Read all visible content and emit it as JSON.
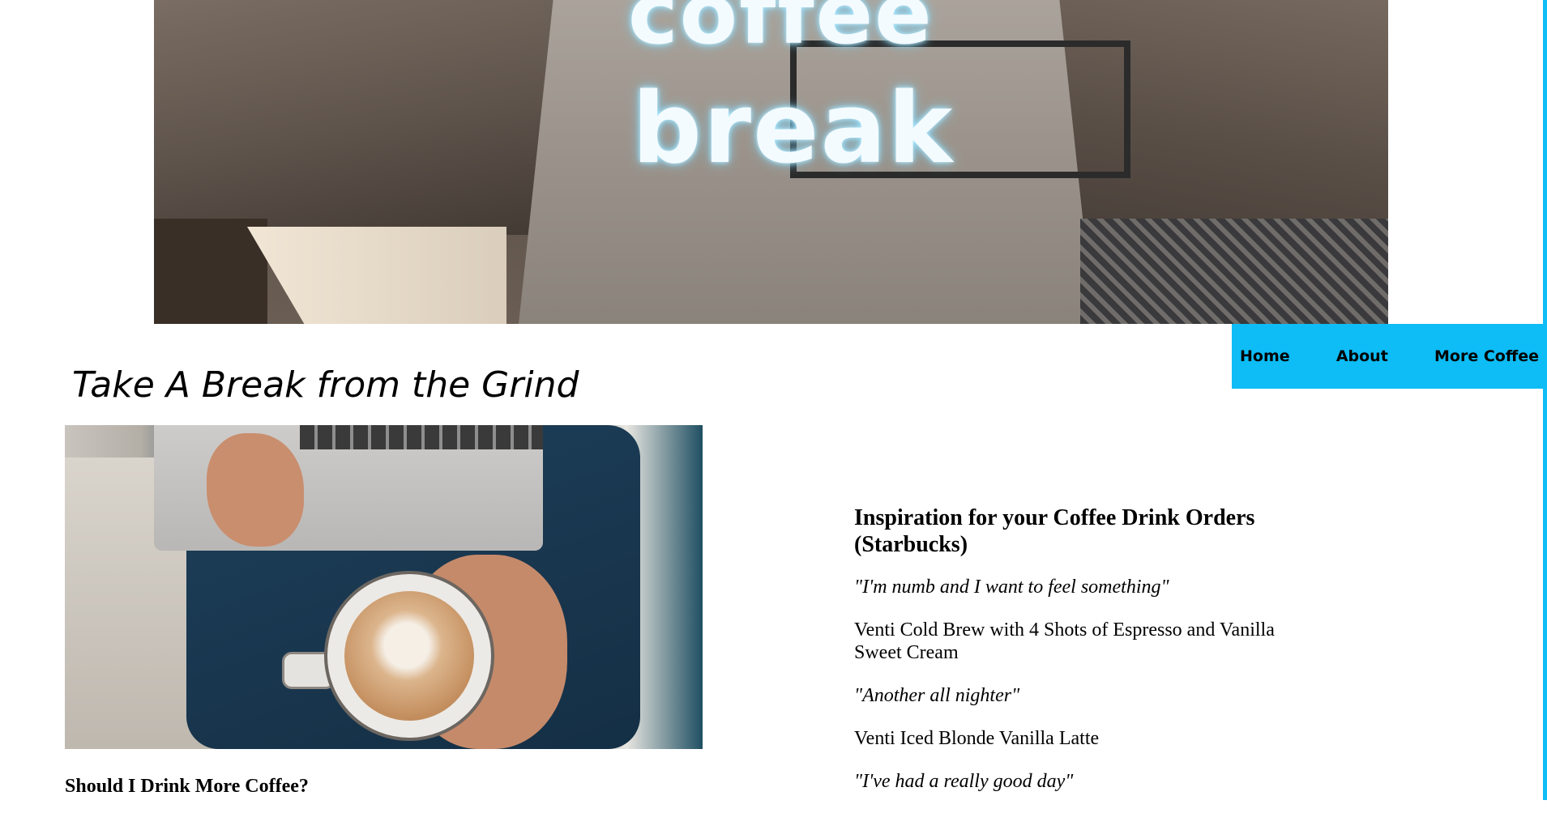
{
  "hero": {
    "sign_line1": "coffee",
    "sign_line2": "break"
  },
  "nav": {
    "items": [
      "Home",
      "About",
      "More Coffee"
    ]
  },
  "page": {
    "title": "Take A Break from the Grind",
    "photo_caption": "Should I Drink More Coffee?"
  },
  "orders": {
    "heading": "Inspiration for your Coffee Drink Orders (Starbucks)",
    "entries": [
      {
        "quote": "\"I'm numb and I want to feel something\"",
        "drink": "Venti Cold Brew with 4 Shots of Espresso and Vanilla Sweet Cream"
      },
      {
        "quote": "\"Another all nighter\"",
        "drink": "Venti Iced Blonde Vanilla Latte"
      },
      {
        "quote": "\"I've had a really good day\""
      }
    ]
  },
  "colors": {
    "accent": "#0ebcf6",
    "background": "#ffffff",
    "text": "#000000"
  }
}
